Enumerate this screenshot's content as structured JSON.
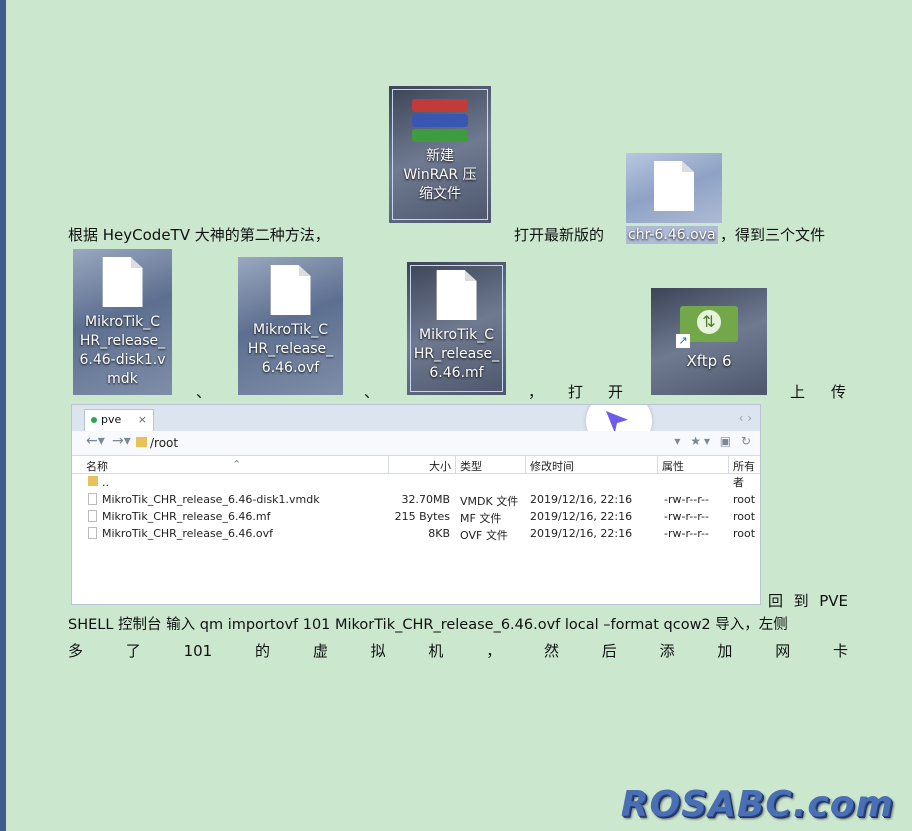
{
  "paragraph1": {
    "part_a": "根据 HeyCodeTV 大神的第二种方法，",
    "part_b": "打开最新版的",
    "ova_file": "chr-6.46.ova",
    "part_c": "，得到三个文件"
  },
  "winrar_icon": {
    "label_line1": "新建",
    "label_line2": "WinRAR 压",
    "label_line3": "缩文件"
  },
  "ova_icon": {},
  "files_icons": [
    {
      "line1": "MikroTik_C",
      "line2": "HR_release_",
      "line3": "6.46-disk1.v",
      "line4": "mdk"
    },
    {
      "line1": "MikroTik_C",
      "line2": "HR_release_",
      "line3": "6.46.ovf"
    },
    {
      "line1": "MikroTik_C",
      "line2": "HR_release_",
      "line3": "6.46.mf"
    }
  ],
  "xftp_icon": {
    "label": "Xftp 6"
  },
  "separators": {
    "comma1": "、",
    "comma2": "、",
    "comma3": "，",
    "open1": "打",
    "open2": "开",
    "upload1": "上",
    "upload2": "传"
  },
  "file_manager": {
    "tab": {
      "label": "pve",
      "close": "×"
    },
    "address": "/root",
    "columns": {
      "name": "名称",
      "size": "大小",
      "type": "类型",
      "modified": "修改时间",
      "attrs": "属性",
      "owner": "所有者"
    },
    "up_row": "..",
    "rows": [
      {
        "name": "MikroTik_CHR_release_6.46-disk1.vmdk",
        "size": "32.70MB",
        "type": "VMDK 文件",
        "modified": "2019/12/16, 22:16",
        "attrs": "-rw-r--r--",
        "owner": "root"
      },
      {
        "name": "MikroTik_CHR_release_6.46.mf",
        "size": "215 Bytes",
        "type": "MF 文件",
        "modified": "2019/12/16, 22:16",
        "attrs": "-rw-r--r--",
        "owner": "root"
      },
      {
        "name": "MikroTik_CHR_release_6.46.ovf",
        "size": "8KB",
        "type": "OVF 文件",
        "modified": "2019/12/16, 22:16",
        "attrs": "-rw-r--r--",
        "owner": "root"
      }
    ]
  },
  "paragraph2": {
    "line1_words": [
      "回",
      "到",
      "PVE"
    ],
    "line2": "SHELL  控制台  输入  qm importovf 101 MikorTik_CHR_release_6.46.ovf local –format qcow2  导入，左侧",
    "line3_words": [
      "多",
      "了",
      "101",
      "的",
      "虚",
      "拟",
      "机",
      "，",
      "然",
      "后",
      "添",
      "加",
      "网",
      "卡"
    ]
  },
  "watermark": "ROSABC.com"
}
